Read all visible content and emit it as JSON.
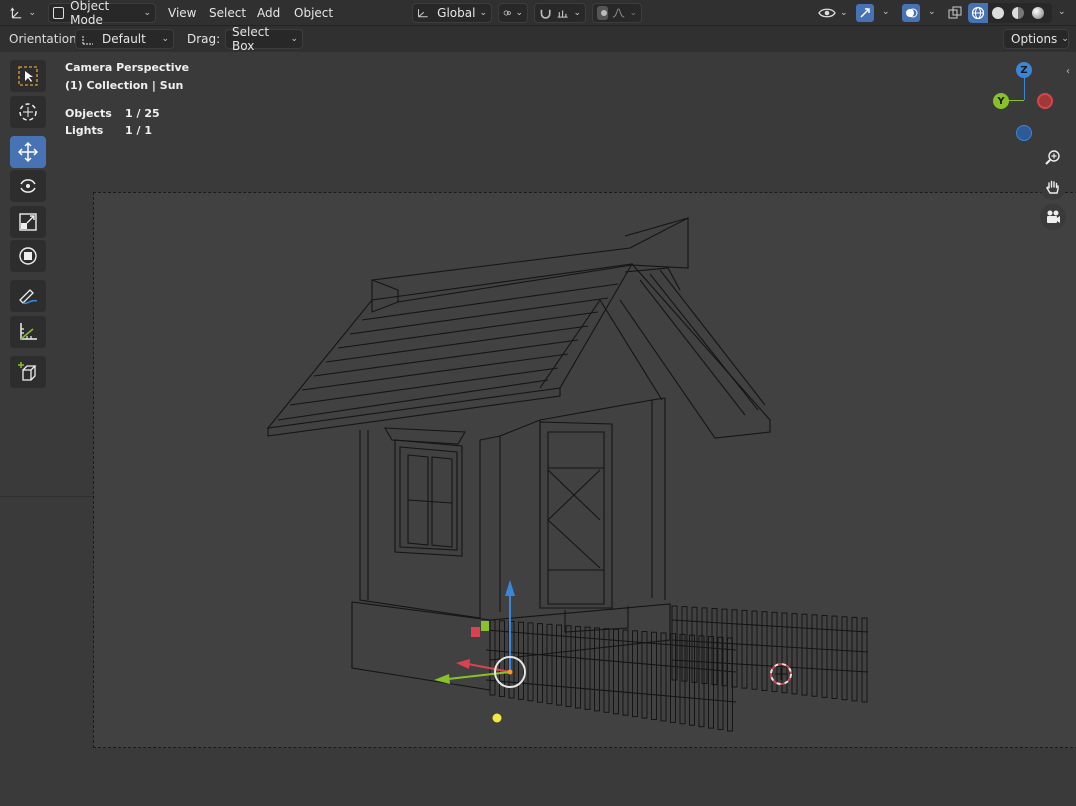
{
  "header": {
    "editor_type_icon": "transform-axes-icon",
    "mode": "Object Mode",
    "menus": [
      "View",
      "Select",
      "Add",
      "Object"
    ],
    "transform_orientation": "Global",
    "icons_right": [
      "eye-visibility-icon",
      "gizmo-icon",
      "overlay-icon",
      "xray-icon",
      "wireframe-shading-icon",
      "solid-shading-icon",
      "material-shading-icon",
      "rendered-shading-icon"
    ]
  },
  "tool_settings": {
    "orientation_label": "Orientation:",
    "orientation_value": "Default",
    "drag_label": "Drag:",
    "drag_value": "Select Box",
    "options_label": "Options"
  },
  "viewport_info": {
    "view_name": "Camera Perspective",
    "collection_line": "(1) Collection | Sun",
    "objects_label": "Objects",
    "objects_value": "1 / 25",
    "lights_label": "Lights",
    "lights_value": "1 / 1"
  },
  "toolbar": [
    {
      "name": "select-box-tool",
      "icon": "select-box-icon",
      "active": false
    },
    {
      "name": "cursor-tool",
      "icon": "cursor-icon",
      "active": false
    },
    {
      "name": "move-tool",
      "icon": "move-icon",
      "active": true
    },
    {
      "name": "rotate-tool",
      "icon": "rotate-icon",
      "active": false
    },
    {
      "name": "scale-tool",
      "icon": "scale-icon",
      "active": false
    },
    {
      "name": "transform-tool",
      "icon": "transform-icon",
      "active": false
    },
    {
      "name": "annotate-tool",
      "icon": "annotate-icon",
      "active": false
    },
    {
      "name": "measure-tool",
      "icon": "measure-icon",
      "active": false
    },
    {
      "name": "add-cube-tool",
      "icon": "add-cube-icon",
      "active": false
    }
  ],
  "nav_gizmo": {
    "z_label": "Z",
    "y_label": "Y"
  },
  "colors": {
    "accent": "#4772b3",
    "x_axis": "#d9434f",
    "y_axis": "#89c12a",
    "z_axis": "#3c86d8",
    "light": "#f5e642"
  }
}
